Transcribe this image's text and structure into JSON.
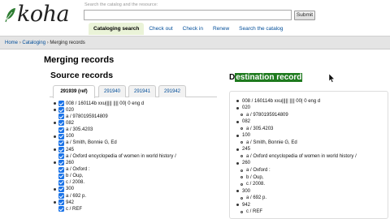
{
  "header": {
    "logo_text": "koha",
    "search_hint": "Search the catalog and the resource:",
    "search_value": "",
    "submit_label": "Submit",
    "tabs": [
      {
        "label": "Cataloging search",
        "active": true
      },
      {
        "label": "Check out",
        "active": false
      },
      {
        "label": "Check in",
        "active": false
      },
      {
        "label": "Renew",
        "active": false
      },
      {
        "label": "Search the catalog",
        "active": false
      }
    ]
  },
  "breadcrumbs": {
    "home": "Home",
    "cataloging": "Cataloging",
    "current": "Merging records",
    "sep": "›"
  },
  "page_title": "Merging records",
  "source": {
    "title": "Source records",
    "tabs": [
      {
        "label": "291939 (ref)",
        "active": true
      },
      {
        "label": "291940",
        "active": false
      },
      {
        "label": "291941",
        "active": false
      },
      {
        "label": "291942",
        "active": false
      }
    ],
    "lines": [
      {
        "text": "008 / 160114b xxu||||| |||| 00| 0 eng d",
        "indent": 0
      },
      {
        "text": "020",
        "indent": 0
      },
      {
        "text": "a / 9780195914809",
        "indent": 1
      },
      {
        "text": "082",
        "indent": 0
      },
      {
        "text": "a / 305.4203",
        "indent": 1
      },
      {
        "text": "100",
        "indent": 0
      },
      {
        "text": "a / Smith, Bonnie G, Ed",
        "indent": 1
      },
      {
        "text": "245",
        "indent": 0
      },
      {
        "text": "a / Oxford encyclopedia of women in world history /",
        "indent": 1
      },
      {
        "text": "260",
        "indent": 0
      },
      {
        "text": "a / Oxford :",
        "indent": 1
      },
      {
        "text": "b / Oup,",
        "indent": 1
      },
      {
        "text": "c / 2008.",
        "indent": 1
      },
      {
        "text": "300",
        "indent": 0
      },
      {
        "text": "a / 692 p.",
        "indent": 1
      },
      {
        "text": "942",
        "indent": 0
      },
      {
        "text": "c / REF",
        "indent": 1
      }
    ]
  },
  "destination": {
    "title_plain": "D",
    "title_highlight": "estination record",
    "lines": [
      {
        "text": "008 / 160114b xxu||||| |||| 00| 0 eng d",
        "level": 0
      },
      {
        "text": "020",
        "level": 0
      },
      {
        "text": "a / 9780195914809",
        "level": 1
      },
      {
        "text": "082",
        "level": 0
      },
      {
        "text": "a / 305.4203",
        "level": 1
      },
      {
        "text": "100",
        "level": 0
      },
      {
        "text": "a / Smith, Bonnie G, Ed",
        "level": 1
      },
      {
        "text": "245",
        "level": 0
      },
      {
        "text": "a / Oxford encyclopedia of women in world history /",
        "level": 1
      },
      {
        "text": "260",
        "level": 0
      },
      {
        "text": "a / Oxford :",
        "level": 1
      },
      {
        "text": "b / Oup,",
        "level": 1
      },
      {
        "text": "c / 2008.",
        "level": 1
      },
      {
        "text": "300",
        "level": 0
      },
      {
        "text": "a / 692 p.",
        "level": 1
      },
      {
        "text": "942",
        "level": 0
      },
      {
        "text": "c / REF",
        "level": 1
      }
    ]
  },
  "colors": {
    "link": "#004d99",
    "active_tab_bg": "#eaf3d8",
    "checkbox": "#1a73e8",
    "highlight": "#1e7a1e"
  }
}
